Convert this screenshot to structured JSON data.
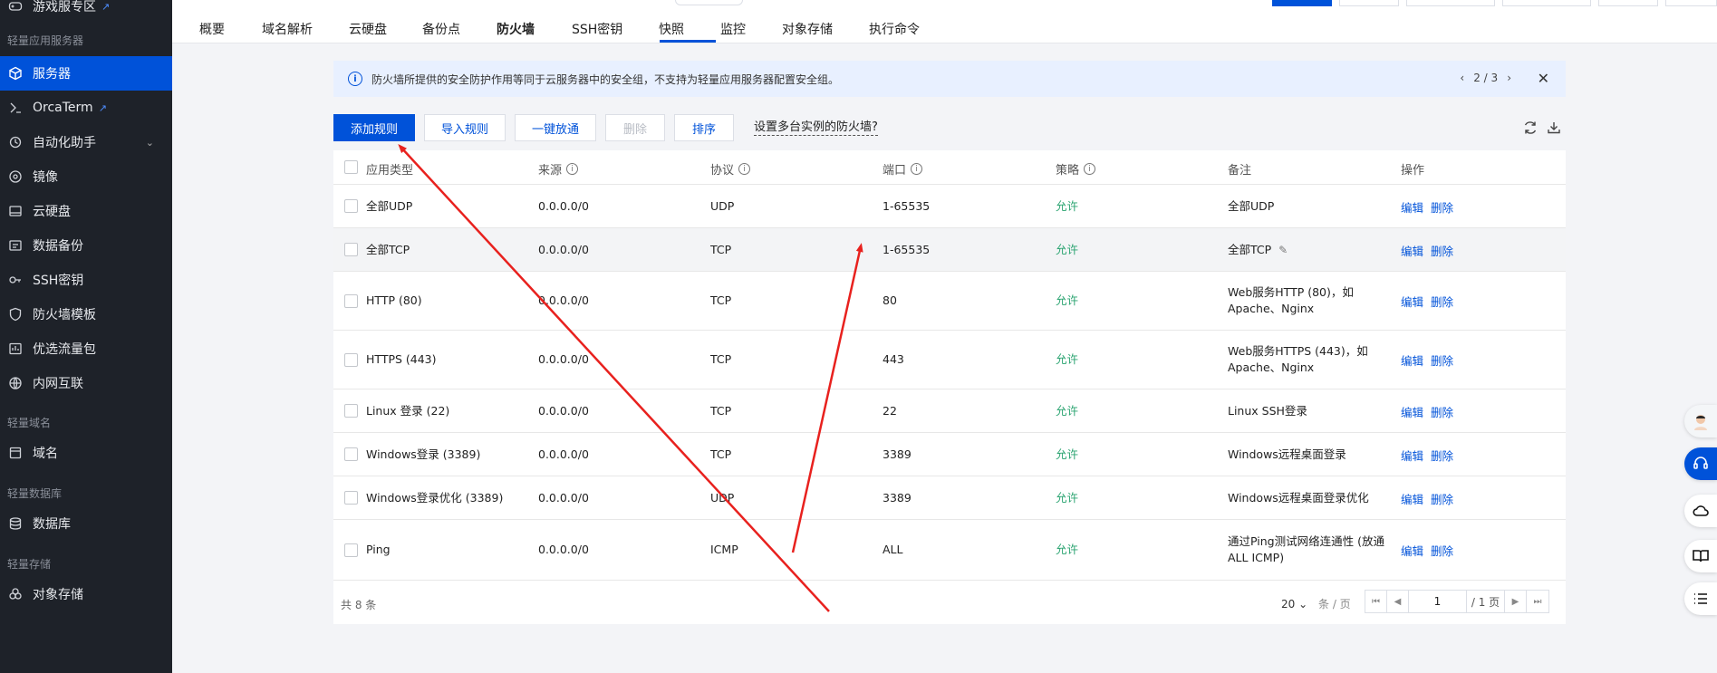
{
  "sidebar": {
    "items": [
      {
        "label": "游戏服专区",
        "icon": "gamepad-icon"
      },
      {
        "label": "服务器",
        "icon": "cube-icon"
      },
      {
        "label": "OrcaTerm",
        "icon": "terminal-icon"
      },
      {
        "label": "自动化助手",
        "icon": "automation-icon"
      },
      {
        "label": "镜像",
        "icon": "disc-icon"
      },
      {
        "label": "云硬盘",
        "icon": "disk-icon"
      },
      {
        "label": "数据备份",
        "icon": "backup-icon"
      },
      {
        "label": "SSH密钥",
        "icon": "key-icon"
      },
      {
        "label": "防火墙模板",
        "icon": "shield-icon"
      },
      {
        "label": "优选流量包",
        "icon": "package-icon"
      },
      {
        "label": "内网互联",
        "icon": "network-icon"
      },
      {
        "label": "域名",
        "icon": "domain-icon"
      },
      {
        "label": "数据库",
        "icon": "database-icon"
      },
      {
        "label": "对象存储",
        "icon": "storage-icon"
      }
    ],
    "groups": {
      "g1": "轻量应用服务器",
      "g2": "轻量域名",
      "g3": "轻量数据库",
      "g4": "轻量存储"
    }
  },
  "tabs": [
    "概要",
    "域名解析",
    "云硬盘",
    "备份点",
    "防火墙",
    "SSH密钥",
    "快照",
    "监控",
    "对象存储",
    "执行命令"
  ],
  "banner": {
    "text": "防火墙所提供的安全防护作用等同于云服务器中的安全组，不支持为轻量应用服务器配置安全组。",
    "pager": "2 / 3"
  },
  "toolbar": {
    "add": "添加规则",
    "import": "导入规则",
    "open_all": "一键放通",
    "delete": "删除",
    "sort": "排序",
    "multi_link": "设置多台实例的防火墙?"
  },
  "table": {
    "headers": {
      "type": "应用类型",
      "source": "来源",
      "protocol": "协议",
      "port": "端口",
      "policy": "策略",
      "note": "备注",
      "ops": "操作"
    },
    "rows": [
      {
        "type": "全部UDP",
        "source": "0.0.0.0/0",
        "protocol": "UDP",
        "port": "1-65535",
        "policy": "允许",
        "note": "全部UDP",
        "note2": ""
      },
      {
        "type": "全部TCP",
        "source": "0.0.0.0/0",
        "protocol": "TCP",
        "port": "1-65535",
        "policy": "允许",
        "note": "全部TCP",
        "note2": ""
      },
      {
        "type": "HTTP (80)",
        "source": "0.0.0.0/0",
        "protocol": "TCP",
        "port": "80",
        "policy": "允许",
        "note": "Web服务HTTP (80)，如",
        "note2": "Apache、Nginx"
      },
      {
        "type": "HTTPS (443)",
        "source": "0.0.0.0/0",
        "protocol": "TCP",
        "port": "443",
        "policy": "允许",
        "note": "Web服务HTTPS (443)，如",
        "note2": "Apache、Nginx"
      },
      {
        "type": "Linux 登录 (22)",
        "source": "0.0.0.0/0",
        "protocol": "TCP",
        "port": "22",
        "policy": "允许",
        "note": "Linux SSH登录",
        "note2": ""
      },
      {
        "type": "Windows登录 (3389)",
        "source": "0.0.0.0/0",
        "protocol": "TCP",
        "port": "3389",
        "policy": "允许",
        "note": "Windows远程桌面登录",
        "note2": ""
      },
      {
        "type": "Windows登录优化 (3389)",
        "source": "0.0.0.0/0",
        "protocol": "UDP",
        "port": "3389",
        "policy": "允许",
        "note": "Windows远程桌面登录优化",
        "note2": ""
      },
      {
        "type": "Ping",
        "source": "0.0.0.0/0",
        "protocol": "ICMP",
        "port": "ALL",
        "policy": "允许",
        "note": "通过Ping测试网络连通性 (放通",
        "note2": "ALL ICMP)"
      }
    ],
    "edit": "编辑",
    "delete": "删除"
  },
  "footer": {
    "total": "共 8 条",
    "page_size": "20",
    "page_size_unit": "条 / 页",
    "page": "1",
    "page_total": "/ 1 页"
  },
  "colors": {
    "primary": "#0052d9",
    "allow": "#2ba471",
    "annotation_arrow": "#e8211e"
  }
}
